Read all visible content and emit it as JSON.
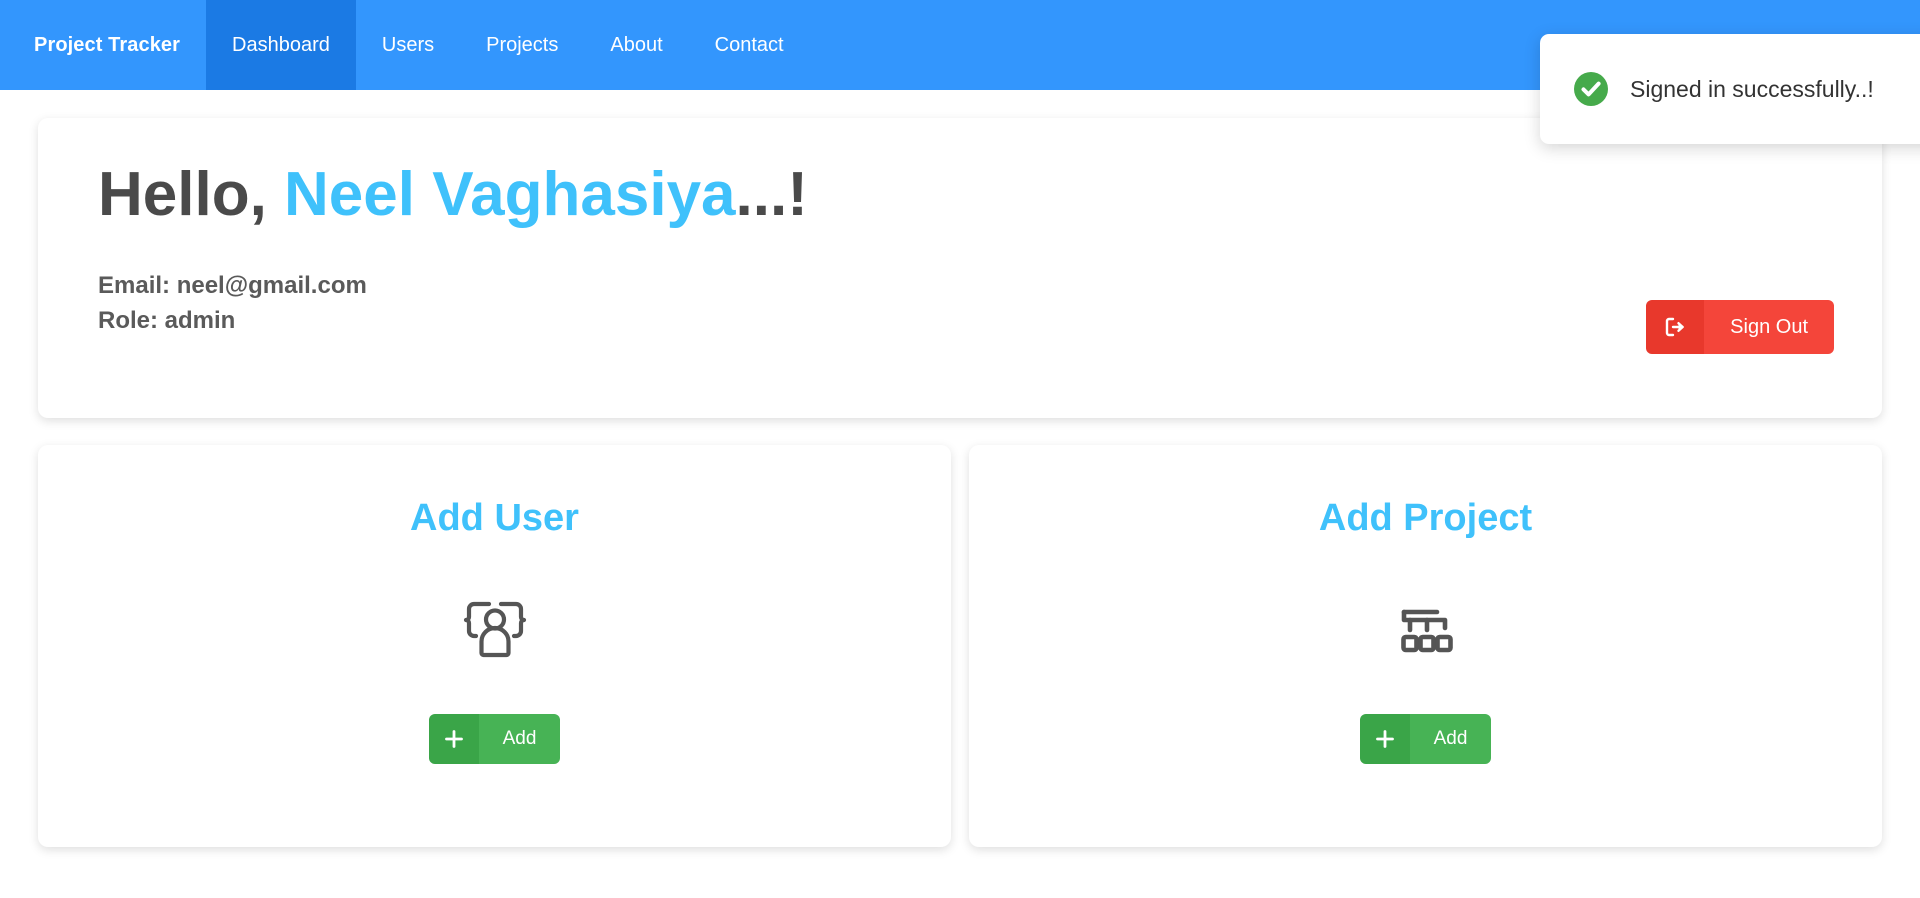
{
  "navbar": {
    "brand": "Project Tracker",
    "bg_color": "#3396fd",
    "active_bg_color": "#1b7ae4",
    "items": [
      {
        "label": "Dashboard",
        "active": true
      },
      {
        "label": "Users",
        "active": false
      },
      {
        "label": "Projects",
        "active": false
      },
      {
        "label": "About",
        "active": false
      },
      {
        "label": "Contact",
        "active": false
      }
    ]
  },
  "toast": {
    "message": "Signed in successfully..!",
    "icon": "check-circle-icon",
    "icon_color": "#46aa4b"
  },
  "hero": {
    "greeting_prefix": "Hello, ",
    "user_name": "Neel Vaghasiya",
    "greeting_suffix": "...!",
    "accent_color": "#3fc1fb",
    "email_line": "Email: neel@gmail.com",
    "role_line": "Role: admin",
    "signout": {
      "label": "Sign Out",
      "icon": "sign-out-icon",
      "color": "#f4453a"
    }
  },
  "cards": [
    {
      "title": "Add User",
      "illustration": "users-group-icon",
      "button_label": "Add",
      "button_icon": "plus-icon",
      "button_color": "#47b355"
    },
    {
      "title": "Add Project",
      "illustration": "sitemap-icon",
      "button_label": "Add",
      "button_icon": "plus-icon",
      "button_color": "#47b355"
    }
  ]
}
